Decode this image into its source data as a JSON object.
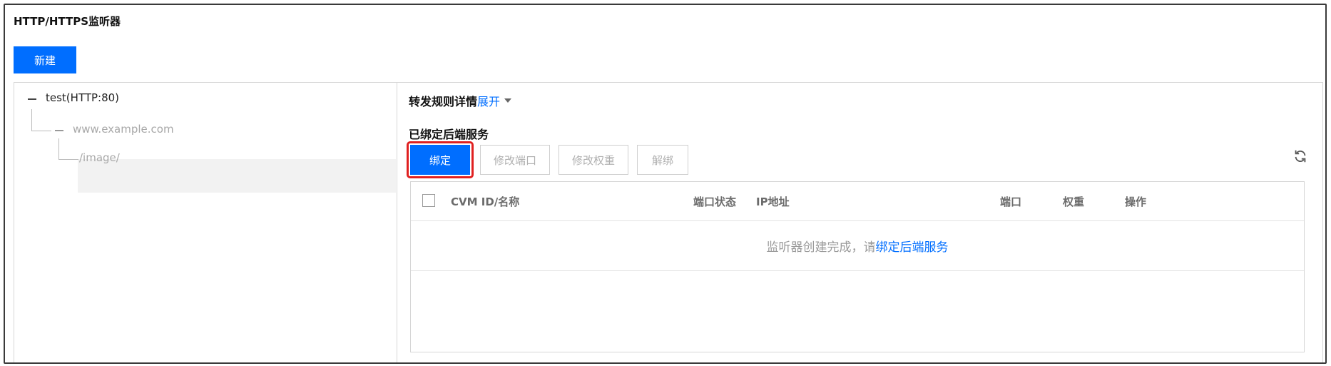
{
  "panel_title": "HTTP/HTTPS监听器",
  "new_button": "新建",
  "tree": {
    "listener": "test(HTTP:80)",
    "domain": "www.example.com",
    "path": "/image/"
  },
  "rule": {
    "title": "转发规则详情",
    "expand": "展开"
  },
  "backend": {
    "title": "已绑定后端服务",
    "buttons": {
      "bind": "绑定",
      "modify_port": "修改端口",
      "modify_weight": "修改权重",
      "unbind": "解绑"
    },
    "table": {
      "columns": {
        "cvm": "CVM ID/名称",
        "port_status": "端口状态",
        "ip": "IP地址",
        "port": "端口",
        "weight": "权重",
        "action": "操作"
      },
      "empty_text": "监听器创建完成，请",
      "empty_link": "绑定后端服务"
    }
  },
  "colors": {
    "primary": "#006eff",
    "highlight": "#e02020"
  }
}
